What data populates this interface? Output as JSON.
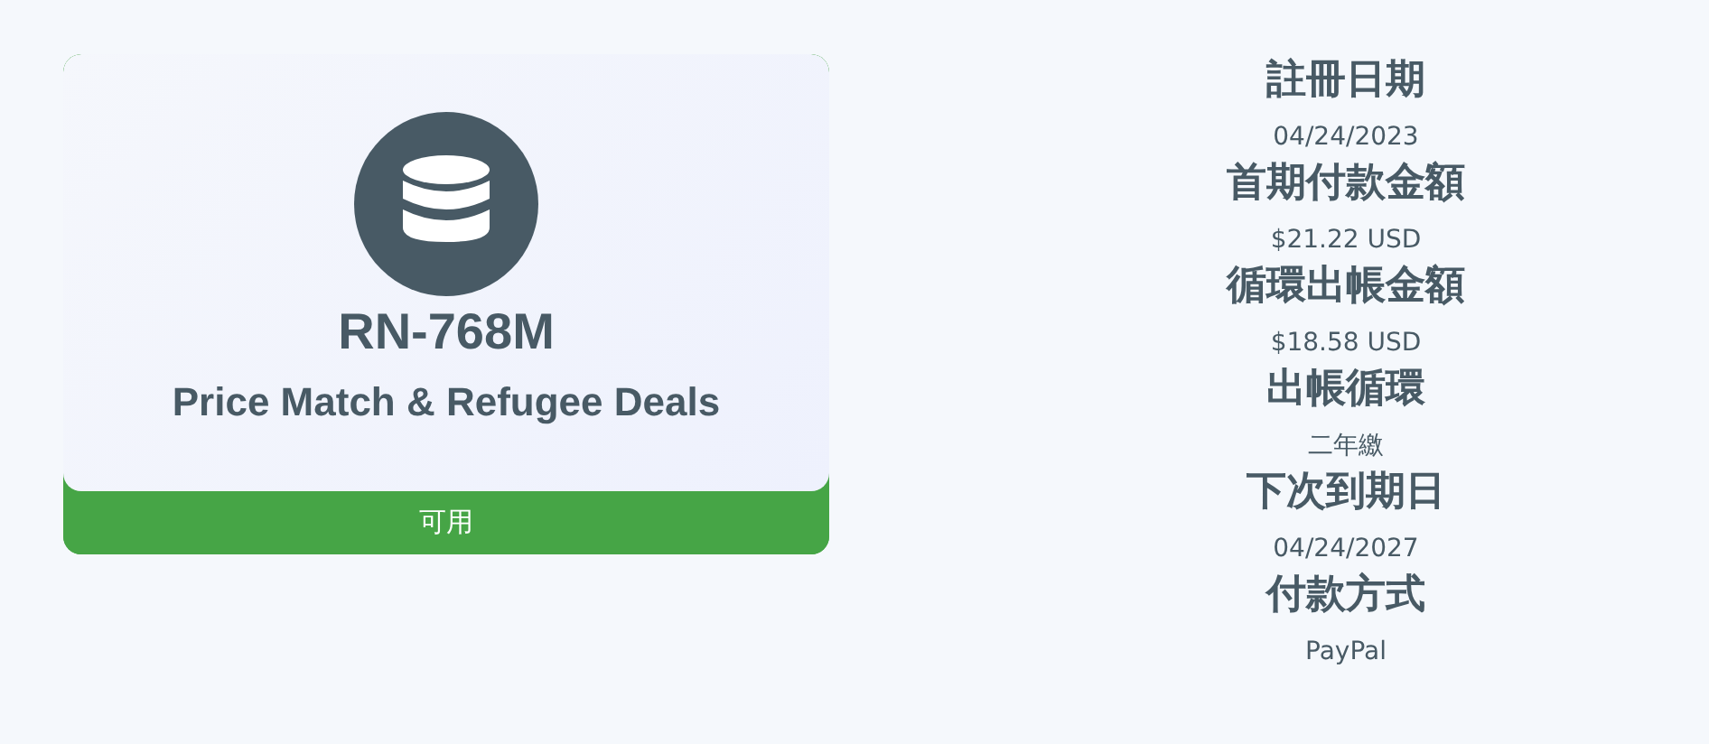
{
  "product": {
    "code": "RN-768M",
    "name": "Price Match & Refugee Deals",
    "status": {
      "label": "可用",
      "kind": "active"
    }
  },
  "details": [
    {
      "label": "註冊日期",
      "value": "04/24/2023"
    },
    {
      "label": "首期付款金額",
      "value": "$21.22 USD"
    },
    {
      "label": "循環出帳金額",
      "value": "$18.58 USD"
    },
    {
      "label": "出帳循環",
      "value": "二年繳"
    },
    {
      "label": "下次到期日",
      "value": "04/24/2027"
    },
    {
      "label": "付款方式",
      "value": "PayPal"
    }
  ]
}
